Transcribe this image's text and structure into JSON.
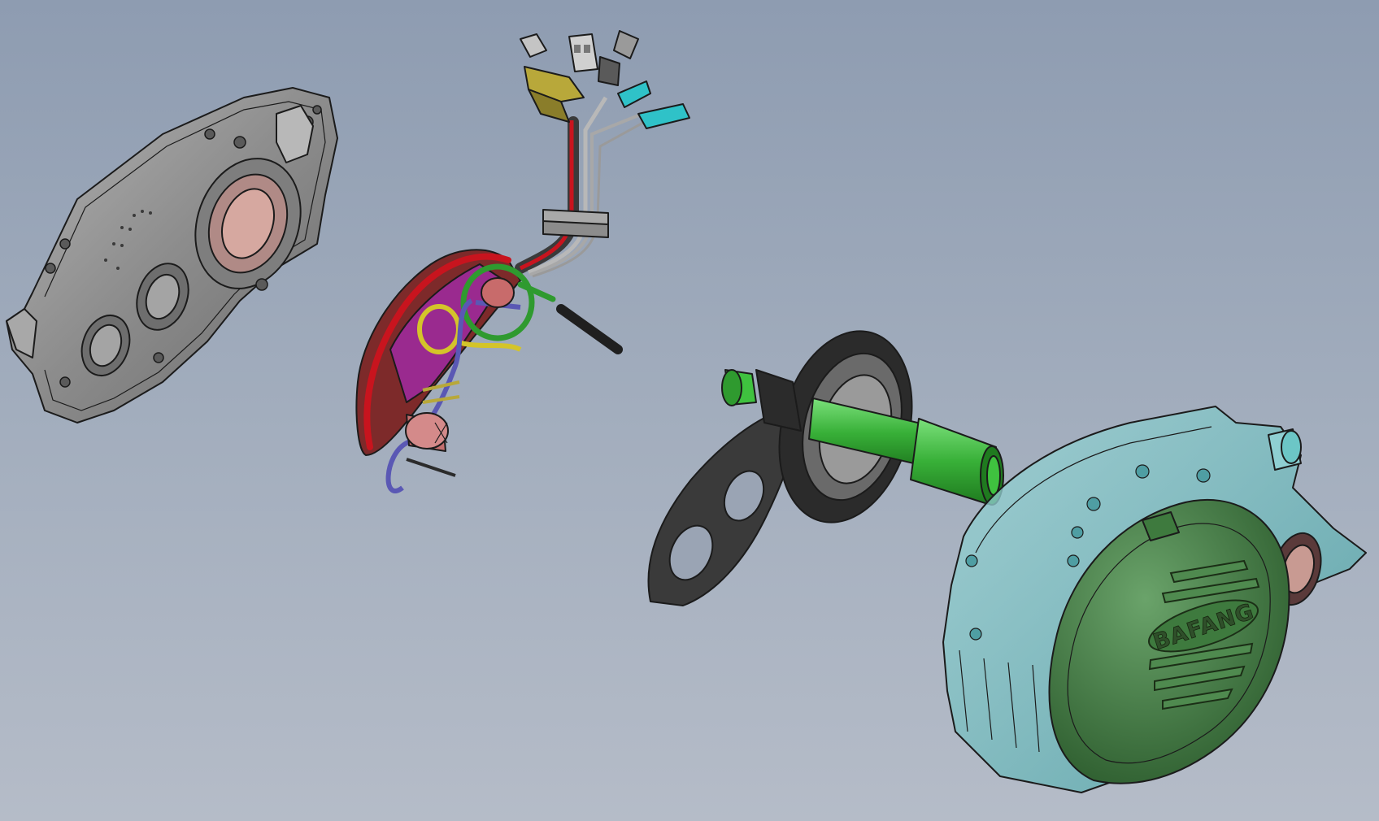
{
  "scene": {
    "background_top": "#8e9cb1",
    "background_bottom": "#b5bcc8"
  },
  "parts": {
    "left_cover": {
      "color": "#9a9a9a",
      "bearing_color": "#c89a92"
    },
    "controller_harness": {
      "board_color": "#9a2a8f",
      "wire_colors": [
        "#c8141e",
        "#2f9a2f",
        "#d4c42a",
        "#5a58b4",
        "#2b2b2b"
      ],
      "connector_colors": [
        "#b5b5b5",
        "#2fc2c8",
        "#b8a83a"
      ]
    },
    "spline_shaft": {
      "color": "#3fc23f",
      "bracket_color": "#3a3a3a"
    },
    "motor_housing": {
      "housing_color": "#6cc6c6",
      "cover_color": "#3e7a3e",
      "logo_text": "BAFANG"
    }
  }
}
